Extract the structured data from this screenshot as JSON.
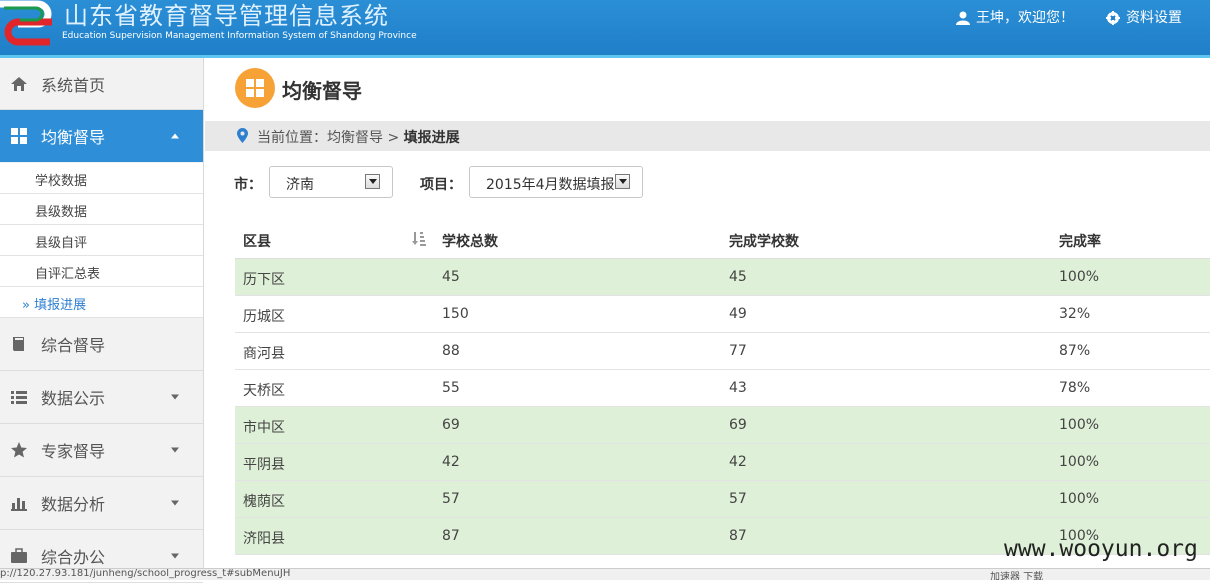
{
  "header": {
    "title": "山东省教育督导管理信息系统",
    "subtitle": "Education Supervision Management Information System of Shandong Province",
    "user_greeting": "王坤，欢迎您！",
    "settings_label": "资料设置"
  },
  "sidebar": {
    "home": "系统首页",
    "balanced": "均衡督导",
    "sub_items": [
      {
        "label": "学校数据"
      },
      {
        "label": "县级数据"
      },
      {
        "label": "县级自评"
      },
      {
        "label": "自评汇总表"
      },
      {
        "label": "» 填报进展"
      }
    ],
    "comprehensive": "综合督导",
    "data_public": "数据公示",
    "expert": "专家督导",
    "analysis": "数据分析",
    "office": "综合办公"
  },
  "page": {
    "title": "均衡督导",
    "breadcrumb_prefix": "当前位置：均衡督导 > ",
    "breadcrumb_current": "填报进展"
  },
  "filters": {
    "city_label": "市：",
    "city_value": "济南",
    "project_label": "项目：",
    "project_value": "2015年4月数据填报"
  },
  "table": {
    "columns": [
      "区县",
      "学校总数",
      "完成学校数",
      "完成率"
    ],
    "rows": [
      {
        "district": "历下区",
        "total": "45",
        "done": "45",
        "rate": "100%",
        "complete": true
      },
      {
        "district": "历城区",
        "total": "150",
        "done": "49",
        "rate": "32%",
        "complete": false
      },
      {
        "district": "商河县",
        "total": "88",
        "done": "77",
        "rate": "87%",
        "complete": false
      },
      {
        "district": "天桥区",
        "total": "55",
        "done": "43",
        "rate": "78%",
        "complete": false
      },
      {
        "district": "市中区",
        "total": "69",
        "done": "69",
        "rate": "100%",
        "complete": true
      },
      {
        "district": "平阴县",
        "total": "42",
        "done": "42",
        "rate": "100%",
        "complete": true
      },
      {
        "district": "槐荫区",
        "total": "57",
        "done": "57",
        "rate": "100%",
        "complete": true
      },
      {
        "district": "济阳县",
        "total": "87",
        "done": "87",
        "rate": "100%",
        "complete": true
      }
    ]
  },
  "watermark": "www.wooyun.org",
  "statusbar": {
    "url": "p://120.27.93.181/junheng/school_progress_t#subMenuJH",
    "tools": "加速器   下载"
  },
  "colors": {
    "header_blue": "#1f7fc8",
    "active_nav": "#2e8ed8",
    "complete_row": "#dff0d8",
    "title_icon": "#f7a237"
  }
}
